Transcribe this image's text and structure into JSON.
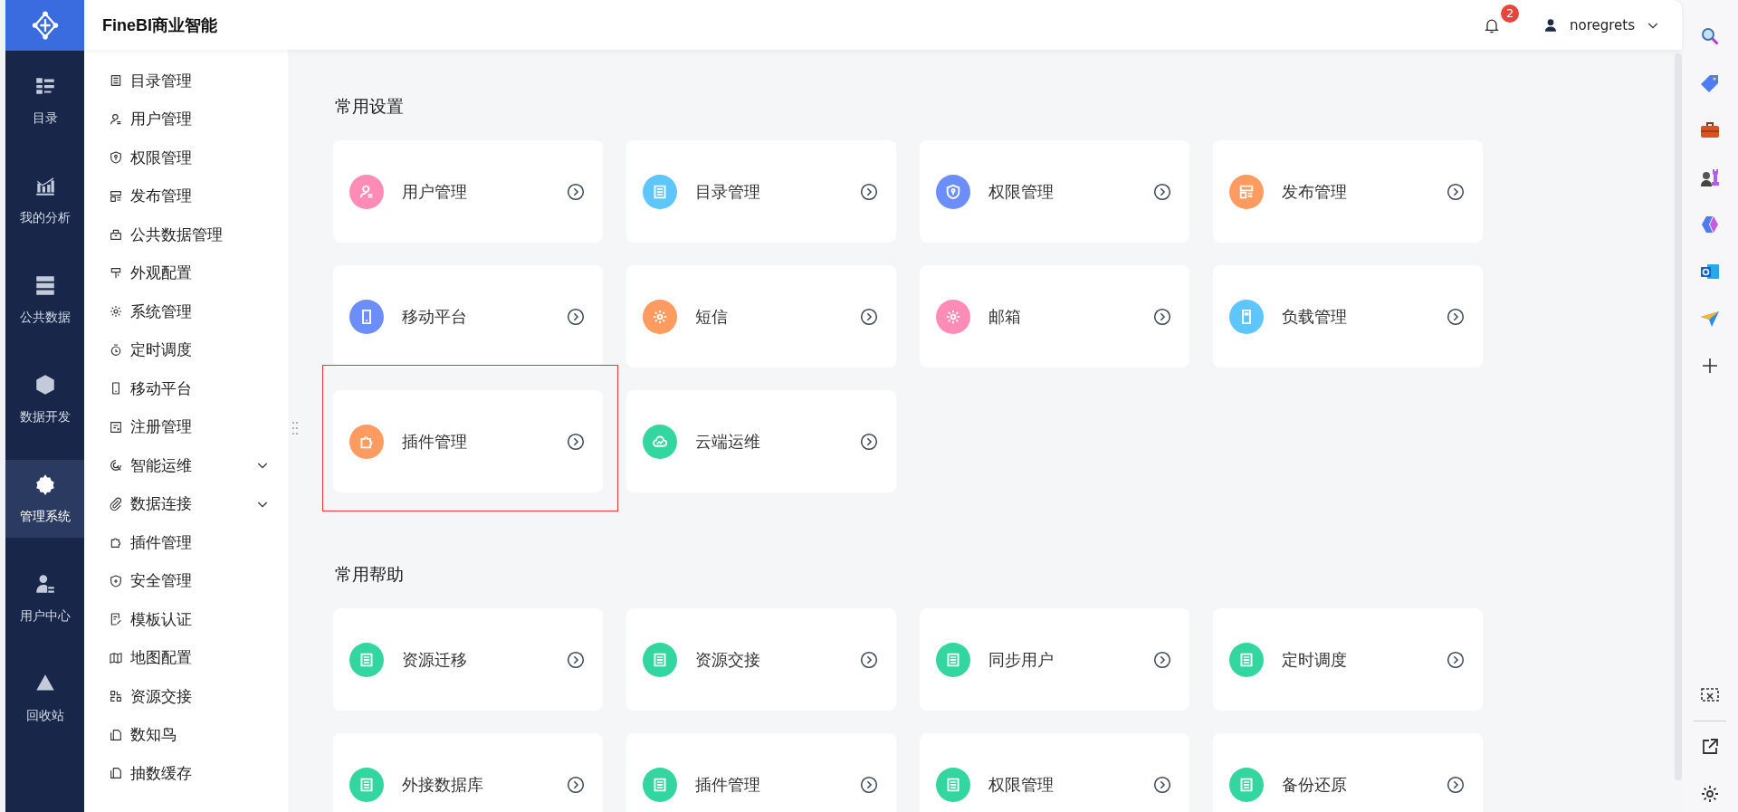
{
  "app": {
    "title": "FineBI商业智能"
  },
  "header": {
    "notification_count": "2",
    "user": "noregrets"
  },
  "rail": [
    {
      "label": "目录",
      "kind": "catalog",
      "selected": false
    },
    {
      "label": "我的分析",
      "kind": "chart",
      "selected": false
    },
    {
      "label": "公共数据",
      "kind": "stack",
      "selected": false
    },
    {
      "label": "数据开发",
      "kind": "cube",
      "selected": false
    },
    {
      "label": "管理系统",
      "kind": "admin",
      "selected": true
    },
    {
      "label": "用户中心",
      "kind": "person",
      "selected": false
    },
    {
      "label": "回收站",
      "kind": "recycle",
      "selected": false
    }
  ],
  "menu": [
    {
      "label": "目录管理",
      "kind": "list"
    },
    {
      "label": "用户管理",
      "kind": "user"
    },
    {
      "label": "权限管理",
      "kind": "shield"
    },
    {
      "label": "发布管理",
      "kind": "layout"
    },
    {
      "label": "公共数据管理",
      "kind": "box"
    },
    {
      "label": "外观配置",
      "kind": "brush"
    },
    {
      "label": "系统管理",
      "kind": "gear"
    },
    {
      "label": "定时调度",
      "kind": "clock"
    },
    {
      "label": "移动平台",
      "kind": "phone"
    },
    {
      "label": "注册管理",
      "kind": "form"
    },
    {
      "label": "智能运维",
      "kind": "scan",
      "expanded": false
    },
    {
      "label": "数据连接",
      "kind": "clip",
      "expanded": false
    },
    {
      "label": "插件管理",
      "kind": "puzzle"
    },
    {
      "label": "安全管理",
      "kind": "shieldplus"
    },
    {
      "label": "模板认证",
      "kind": "docedit"
    },
    {
      "label": "地图配置",
      "kind": "map"
    },
    {
      "label": "资源交接",
      "kind": "exchange"
    },
    {
      "label": "数知鸟",
      "kind": "copy"
    },
    {
      "label": "抽数缓存",
      "kind": "copy"
    }
  ],
  "sections": [
    {
      "title": "常用设置",
      "cards": [
        {
          "label": "用户管理",
          "kind": "user",
          "color": "#ff8cb6"
        },
        {
          "label": "目录管理",
          "kind": "list",
          "color": "#5ec6fb"
        },
        {
          "label": "权限管理",
          "kind": "shield",
          "color": "#6b8efb"
        },
        {
          "label": "发布管理",
          "kind": "layout",
          "color": "#fd9b60"
        },
        {
          "label": "移动平台",
          "kind": "phone",
          "color": "#6b8efb"
        },
        {
          "label": "短信",
          "kind": "gear",
          "color": "#fd9b60"
        },
        {
          "label": "邮箱",
          "kind": "gear",
          "color": "#ff8cb6"
        },
        {
          "label": "负载管理",
          "kind": "card",
          "color": "#5ec6fb"
        },
        {
          "label": "插件管理",
          "kind": "puzzle",
          "color": "#fd9b60",
          "highlighted": true
        },
        {
          "label": "云端运维",
          "kind": "cloud",
          "color": "#33d69f"
        }
      ]
    },
    {
      "title": "常用帮助",
      "cards": [
        {
          "label": "资源迁移",
          "kind": "list",
          "color": "#33d69f"
        },
        {
          "label": "资源交接",
          "kind": "list",
          "color": "#33d69f"
        },
        {
          "label": "同步用户",
          "kind": "list",
          "color": "#33d69f"
        },
        {
          "label": "定时调度",
          "kind": "list",
          "color": "#33d69f"
        },
        {
          "label": "外接数据库",
          "kind": "list",
          "color": "#33d69f"
        },
        {
          "label": "插件管理",
          "kind": "list",
          "color": "#33d69f"
        },
        {
          "label": "权限管理",
          "kind": "list",
          "color": "#33d69f"
        },
        {
          "label": "备份还原",
          "kind": "list",
          "color": "#33d69f"
        }
      ]
    }
  ]
}
